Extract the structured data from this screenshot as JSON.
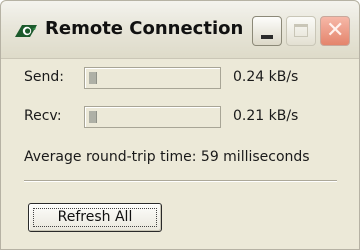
{
  "window": {
    "title": "Remote Connection",
    "app_icon": "remote-connection-icon",
    "controls": {
      "minimize_icon": "minimize-icon",
      "maximize_icon": "maximize-icon",
      "close_icon": "close-icon",
      "close_glyph": "✕"
    }
  },
  "stats": {
    "send": {
      "label": "Send:",
      "value": "0.24 kB/s",
      "meter_fraction": 0.06
    },
    "recv": {
      "label": "Recv:",
      "value": "0.21 kB/s",
      "meter_fraction": 0.06
    },
    "round_trip": "Average round-trip time: 59 milliseconds"
  },
  "actions": {
    "refresh_label": "Refresh All"
  },
  "colors": {
    "window_bg": "#ece9d8",
    "meter_fill": "#aeb0a6",
    "close_button": "#e4846c"
  }
}
